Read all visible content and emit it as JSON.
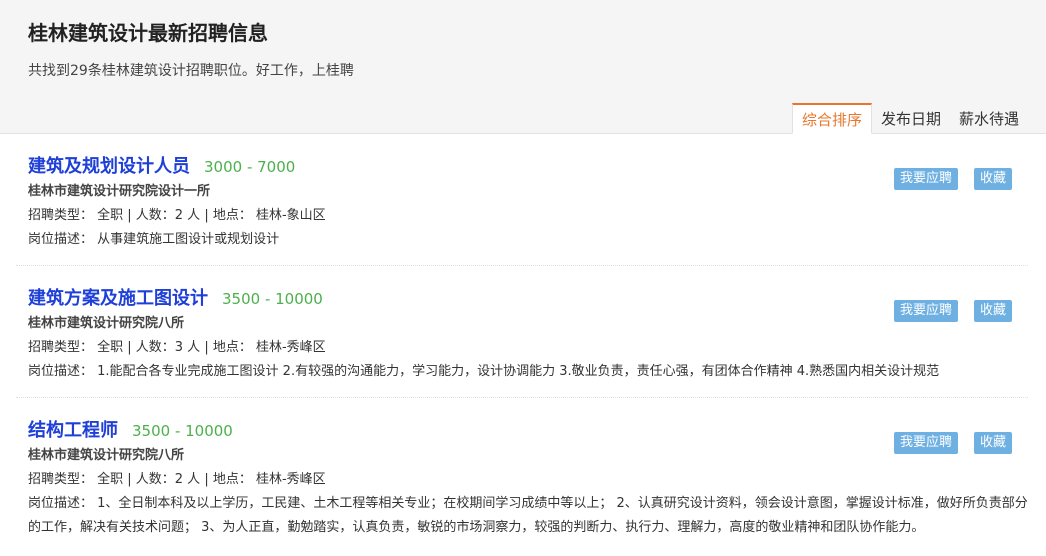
{
  "header": {
    "title": "桂林建筑设计最新招聘信息",
    "subtitle": "共找到29条桂林建筑设计招聘职位。好工作，上桂聘"
  },
  "sort_tabs": [
    {
      "label": "综合排序",
      "active": true
    },
    {
      "label": "发布日期",
      "active": false
    },
    {
      "label": "薪水待遇",
      "active": false
    }
  ],
  "jobs": [
    {
      "title": "建筑及规划设计人员",
      "salary": "3000 - 7000",
      "company": "桂林市建筑设计研究院设计一所",
      "meta": "招聘类型： 全职 | 人数：2 人 | 地点： 桂林-象山区",
      "desc": "岗位描述： 从事建筑施工图设计或规划设计",
      "apply_label": "我要应聘",
      "save_label": "收藏"
    },
    {
      "title": "建筑方案及施工图设计",
      "salary": "3500 - 10000",
      "company": "桂林市建筑设计研究院八所",
      "meta": "招聘类型： 全职 | 人数：3 人 | 地点： 桂林-秀峰区",
      "desc": "岗位描述： 1.能配合各专业完成施工图设计 2.有较强的沟通能力，学习能力，设计协调能力 3.敬业负责，责任心强，有团体合作精神 4.熟悉国内相关设计规范",
      "apply_label": "我要应聘",
      "save_label": "收藏"
    },
    {
      "title": "结构工程师",
      "salary": "3500 - 10000",
      "company": "桂林市建筑设计研究院八所",
      "meta": "招聘类型： 全职 | 人数：2 人 | 地点： 桂林-秀峰区",
      "desc": "岗位描述： 1、全日制本科及以上学历，工民建、土木工程等相关专业；在校期间学习成绩中等以上； 2、认真研究设计资料，领会设计意图，掌握设计标准，做好所负责部分的工作，解决有关技术问题； 3、为人正直，勤勉踏实，认真负责，敏锐的市场洞察力，较强的判断力、执行力、理解力，高度的敬业精神和团队协作能力。",
      "apply_label": "我要应聘",
      "save_label": "收藏"
    }
  ],
  "colors": {
    "accent": "#e8762d",
    "title_link": "#1e3fd8",
    "salary": "#4cb04c",
    "button": "#6fb0e2"
  }
}
